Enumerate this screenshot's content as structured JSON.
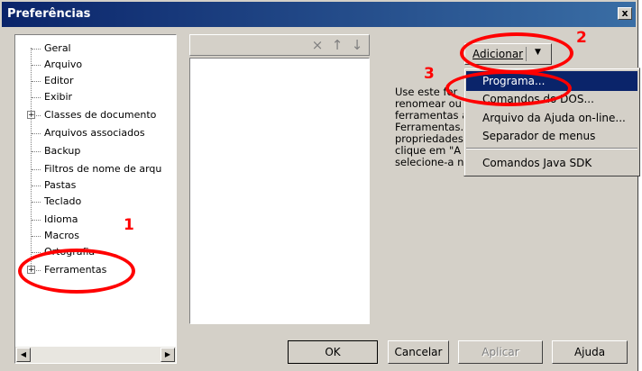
{
  "window": {
    "title": "Preferências"
  },
  "tree": {
    "items": [
      {
        "label": "Geral",
        "expandable": false
      },
      {
        "label": "Arquivo",
        "expandable": false
      },
      {
        "label": "Editor",
        "expandable": false
      },
      {
        "label": "Exibir",
        "expandable": false
      },
      {
        "label": "Classes de documento",
        "expandable": true
      },
      {
        "label": "Arquivos associados",
        "expandable": false
      },
      {
        "label": "Backup",
        "expandable": false
      },
      {
        "label": "Filtros de nome de arqu",
        "expandable": false
      },
      {
        "label": "Pastas",
        "expandable": false
      },
      {
        "label": "Teclado",
        "expandable": false
      },
      {
        "label": "Idioma",
        "expandable": false
      },
      {
        "label": "Macros",
        "expandable": false
      },
      {
        "label": "Ortografia",
        "expandable": false
      },
      {
        "label": "Ferramentas",
        "expandable": true
      }
    ],
    "expander_symbol": "+"
  },
  "toolbar": {
    "delete_icon": "×",
    "up_icon": "↑",
    "down_icon": "↓"
  },
  "add_button": {
    "label": "Adicionar",
    "arrow": "▼"
  },
  "help_text": [
    "Use este for",
    "renomear ou",
    "ferramentas a",
    "Ferramentas.",
    "propriedades",
    "clique em \"A",
    "selecione-a no controle de árvore."
  ],
  "menu": {
    "items": [
      "Programa...",
      "Comandos do DOS...",
      "Arquivo da Ajuda on-line...",
      "Separador de menus",
      "Comandos Java SDK"
    ]
  },
  "buttons": {
    "ok": "OK",
    "cancel": "Cancelar",
    "apply": "Aplicar",
    "help": "Ajuda"
  },
  "annotations": {
    "one": "1",
    "two": "2",
    "three": "3",
    "color": "#ff0000"
  },
  "colors": {
    "titlebar": "#0a246a",
    "selection": "#0a246a",
    "face": "#d4d0c8"
  },
  "close_glyph": "x"
}
